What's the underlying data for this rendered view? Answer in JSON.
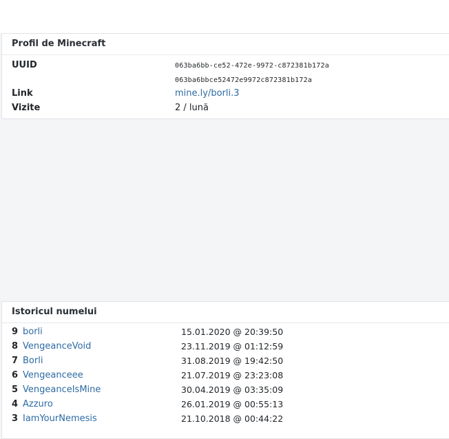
{
  "profile": {
    "title": "Profil de Minecraft",
    "uuid_label": "UUID",
    "uuid_dashed": "063ba6bb-ce52-472e-9972-c872381b172a",
    "uuid_plain": "063ba6bbce52472e9972c872381b172a",
    "link_label": "Link",
    "link_value": "mine.ly/borli.3",
    "visits_label": "Vizite",
    "visits_value": "2 / lună"
  },
  "history": {
    "title": "Istoricul numelui",
    "rows": [
      {
        "num": "9",
        "name": "borli",
        "date": "15.01.2020 @ 20:39:50"
      },
      {
        "num": "8",
        "name": "VengeanceVoid",
        "date": "23.11.2019 @ 01:12:59"
      },
      {
        "num": "7",
        "name": "Borli",
        "date": "31.08.2019 @ 19:42:50"
      },
      {
        "num": "6",
        "name": "Vengeanceee",
        "date": "21.07.2019 @ 23:23:08"
      },
      {
        "num": "5",
        "name": "VengeanceIsMine",
        "date": "30.04.2019 @ 03:35:09"
      },
      {
        "num": "4",
        "name": "Azzuro",
        "date": "26.01.2019 @ 00:55:13"
      },
      {
        "num": "3",
        "name": "IamYourNemesis",
        "date": "21.10.2018 @ 00:44:22"
      }
    ]
  }
}
